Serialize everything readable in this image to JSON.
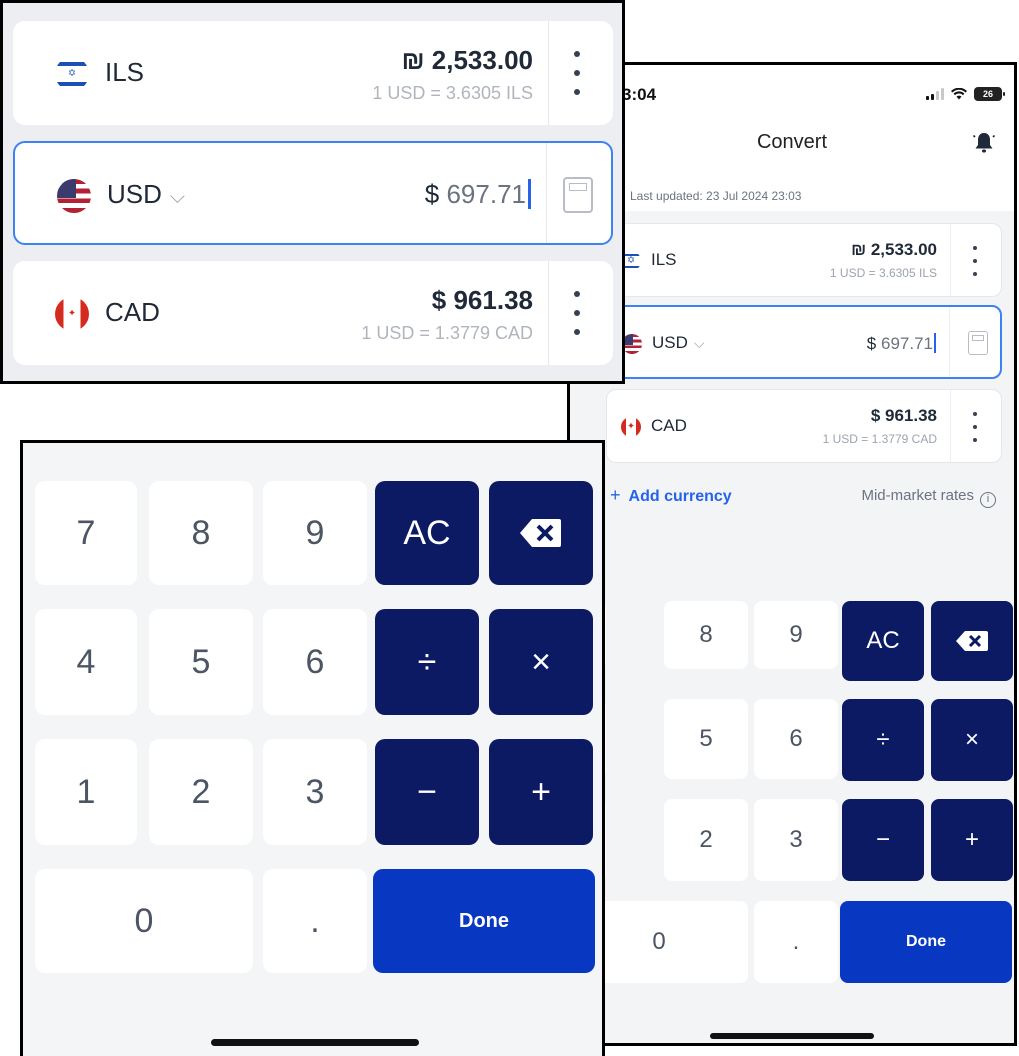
{
  "status_bar": {
    "time": "3:04",
    "battery": "26"
  },
  "screen": {
    "title": "Convert",
    "last_updated": "Last updated: 23 Jul 2024 23:03",
    "add_currency": "Add currency",
    "mid_market": "Mid-market rates",
    "info_glyph": "i"
  },
  "currencies": [
    {
      "code": "ILS",
      "amount": "₪ 2,533.00",
      "rate": "1 USD = 3.6305 ILS",
      "flag": "israel-flag-icon"
    },
    {
      "code": "USD",
      "symbol": "$",
      "value": "697.71",
      "chevron": "⌵",
      "flag": "usa-flag-icon"
    },
    {
      "code": "CAD",
      "amount": "$ 961.38",
      "rate": "1 USD = 1.3779 CAD",
      "flag": "canada-flag-icon"
    }
  ],
  "keypad": {
    "k7": "7",
    "k8": "8",
    "k9": "9",
    "ac": "AC",
    "backspace": "⌫",
    "k4": "4",
    "k5": "5",
    "k6": "6",
    "divide": "÷",
    "multiply": "×",
    "k1": "1",
    "k2": "2",
    "k3": "3",
    "minus": "−",
    "plus": "+",
    "k0": "0",
    "dot": ".",
    "done": "Done"
  },
  "colors": {
    "accent": "#2563eb",
    "operator_key": "#0c1a63",
    "done_key": "#0837c2",
    "active_border": "#3b82f6"
  }
}
